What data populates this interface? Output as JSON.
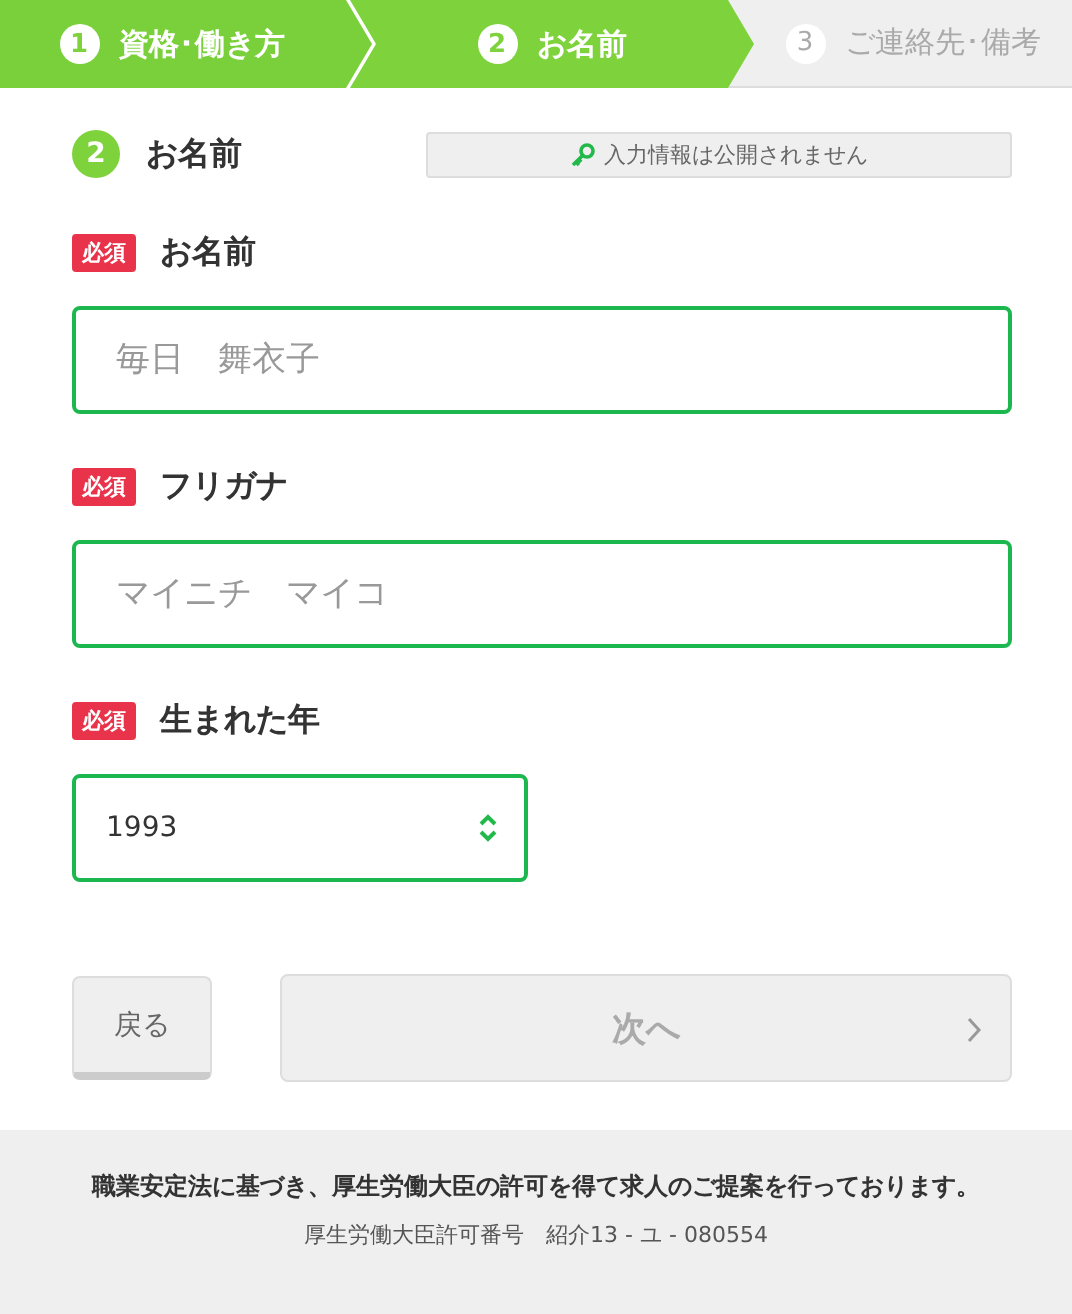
{
  "steps": [
    {
      "number": "1",
      "label": "資格･働き方",
      "kind": "done"
    },
    {
      "number": "2",
      "label": "お名前",
      "kind": "current"
    },
    {
      "number": "3",
      "label": "ご連絡先･備考",
      "kind": "upcoming"
    }
  ],
  "section": {
    "number": "2",
    "title": "お名前",
    "notice": "入力情報は公開されません"
  },
  "fields": [
    {
      "kind": "text",
      "badge": "必須",
      "label": "お名前",
      "placeholder": "毎日　舞衣子"
    },
    {
      "kind": "text",
      "badge": "必須",
      "label": "フリガナ",
      "placeholder": "マイニチ　マイコ"
    },
    {
      "kind": "select",
      "badge": "必須",
      "label": "生まれた年",
      "value": "1993"
    }
  ],
  "back_button": "戻る",
  "next_button": {
    "label": "次へ",
    "disabled": true
  },
  "footer": {
    "statement": "職業安定法に基づき、厚生労働大臣の許可を得て求人のご提案を行っております。",
    "license": "厚生労働大臣許可番号　紹介13 - ユ - 080554"
  }
}
